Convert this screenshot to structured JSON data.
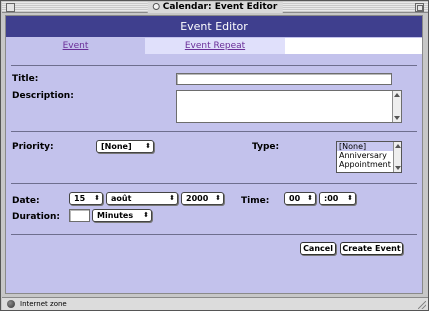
{
  "window": {
    "title": "Calendar: Event Editor"
  },
  "header": {
    "title": "Event Editor"
  },
  "tabs": [
    {
      "label": "Event",
      "active": true
    },
    {
      "label": "Event Repeat",
      "active": false
    }
  ],
  "form": {
    "title_label": "Title:",
    "title_value": "",
    "description_label": "Description:",
    "description_value": "",
    "priority_label": "Priority:",
    "priority_value": "[None]",
    "type_label": "Type:",
    "type_options": [
      "[None]",
      "Anniversary",
      "Appointment"
    ],
    "type_selected": "[None]",
    "date_label": "Date:",
    "date_day": "15",
    "date_month": "août",
    "date_year": "2000",
    "time_label": "Time:",
    "time_hour": "00",
    "time_minute": ":00",
    "duration_label": "Duration:",
    "duration_value": "",
    "duration_unit": "Minutes"
  },
  "buttons": {
    "cancel": "Cancel",
    "create": "Create Event"
  },
  "statusbar": {
    "text": "Internet zone"
  },
  "colors": {
    "header_bg": "#3f3f8e",
    "panel_bg": "#c3c2ec",
    "tab_link": "#6a2e98"
  },
  "popup_arrow": "⬍"
}
